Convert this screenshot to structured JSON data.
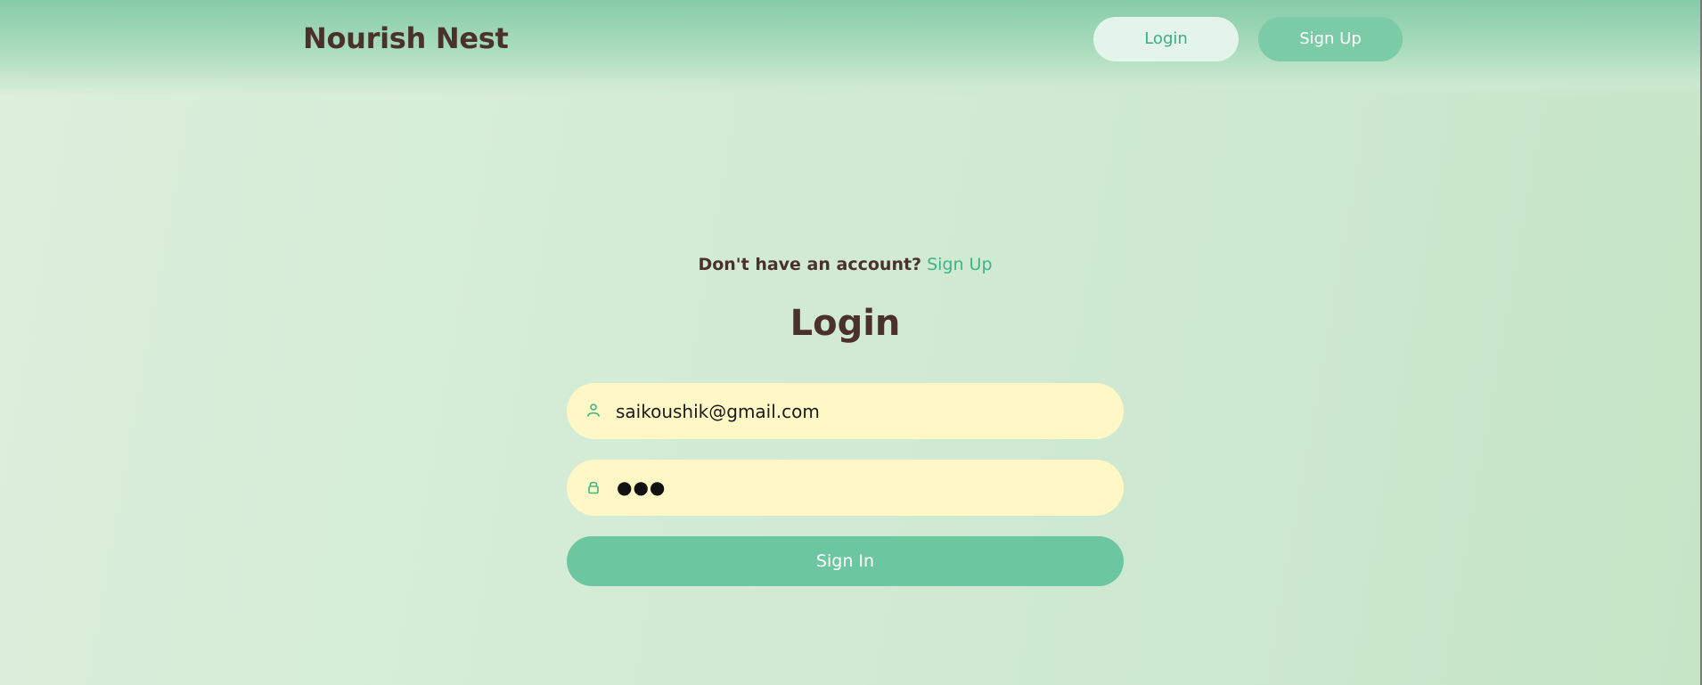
{
  "header": {
    "brand": "Nourish Nest",
    "login_label": "Login",
    "signup_label": "Sign Up"
  },
  "form": {
    "account_question": "Don't have an account?",
    "account_link": "Sign Up",
    "title": "Login",
    "email_value": "saikoushik@gmail.com",
    "password_mask": "●●●",
    "submit_label": "Sign In",
    "email_icon": "user-icon",
    "password_icon": "lock-icon"
  },
  "colors": {
    "brand_text": "#4a3129",
    "accent": "#3fb487",
    "button": "#6cc6a0",
    "input_bg": "#fff8c6"
  }
}
